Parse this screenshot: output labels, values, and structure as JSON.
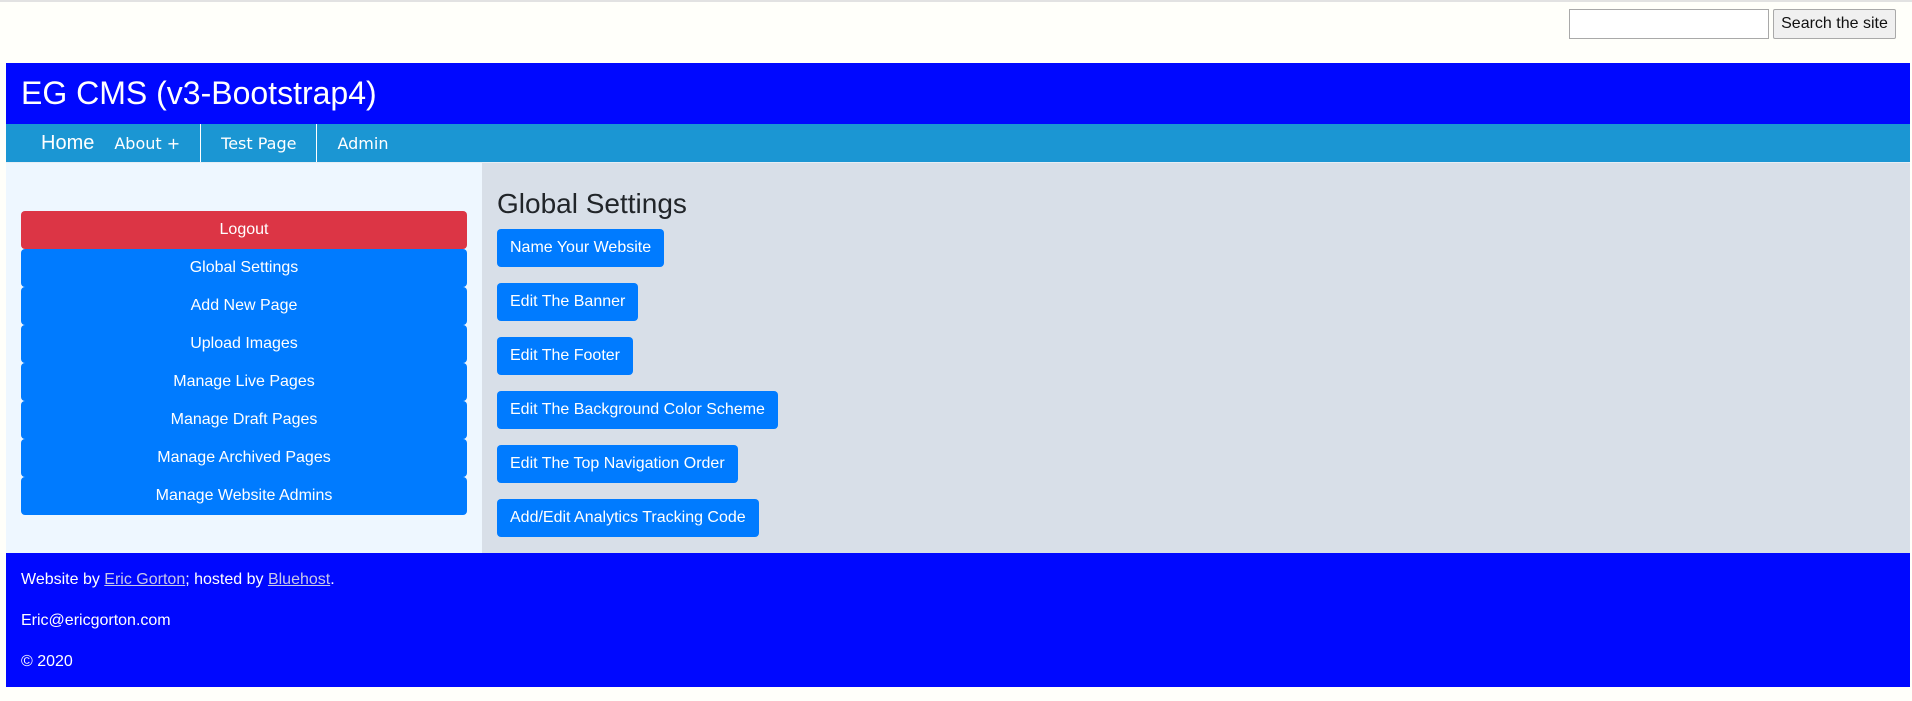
{
  "search": {
    "value": "",
    "placeholder": "",
    "button_label": "Search the site"
  },
  "banner": {
    "title": "EG CMS (v3-Bootstrap4)"
  },
  "nav": {
    "items": [
      {
        "label": "Home"
      },
      {
        "label": "About +"
      },
      {
        "label": "Test Page"
      },
      {
        "label": "Admin"
      }
    ]
  },
  "sidebar": {
    "items": [
      {
        "label": "Logout"
      },
      {
        "label": "Global Settings"
      },
      {
        "label": "Add New Page"
      },
      {
        "label": "Upload Images"
      },
      {
        "label": "Manage Live Pages"
      },
      {
        "label": "Manage Draft Pages"
      },
      {
        "label": "Manage Archived Pages"
      },
      {
        "label": "Manage Website Admins"
      }
    ]
  },
  "main": {
    "title": "Global Settings",
    "buttons": [
      {
        "label": "Name Your Website"
      },
      {
        "label": "Edit The Banner"
      },
      {
        "label": "Edit The Footer"
      },
      {
        "label": "Edit The Background Color Scheme"
      },
      {
        "label": "Edit The Top Navigation Order"
      },
      {
        "label": "Add/Edit Analytics Tracking Code"
      }
    ]
  },
  "footer": {
    "credit_prefix": "Website by ",
    "author_link": "Eric Gorton",
    "credit_middle": "; hosted by ",
    "host_link": "Bluehost",
    "credit_suffix": ".",
    "email": "Eric@ericgorton.com",
    "copyright": "© 2020"
  },
  "colors": {
    "banner": "#0008ff",
    "nav": "#1b96d3",
    "primary_button": "#007bff",
    "danger_button": "#dc3545",
    "sidebar_bg": "#eef7ff",
    "main_bg": "#d8dfe8"
  }
}
